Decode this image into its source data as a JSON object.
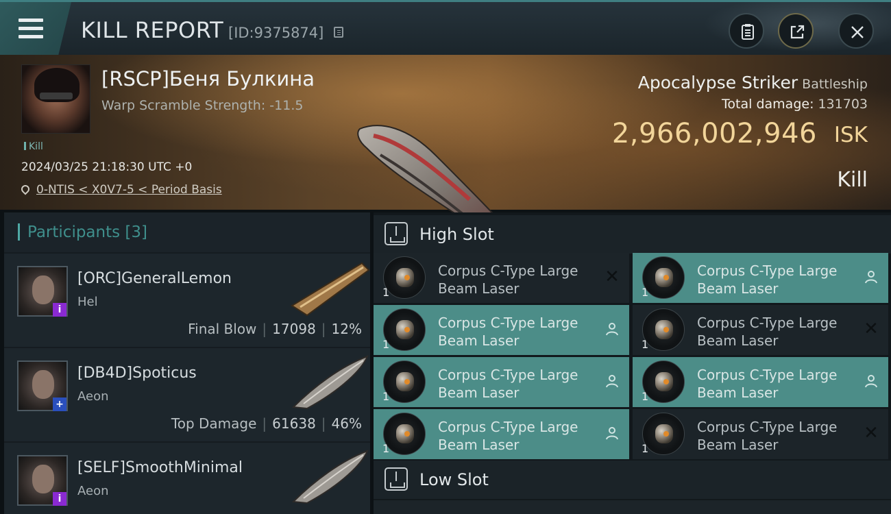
{
  "header": {
    "title": "KILL REPORT",
    "id_label": "[ID:9375874]"
  },
  "victim": {
    "name": "[RSCP]Беня Булкина",
    "warp_scramble": "Warp Scramble Strength: -11.5",
    "kill_tag": "Kill",
    "timestamp": "2024/03/25 21:18:30 UTC +0",
    "location": "0-NTIS < X0V7-5 < Period Basis",
    "ship_name": "Apocalypse Striker",
    "ship_class": "Battleship",
    "total_damage_label": "Total damage:",
    "total_damage": "131703",
    "isk_value": "2,966,002,946",
    "isk_unit": "ISK",
    "outcome": "Kill"
  },
  "participants": {
    "label": "Participants [3]",
    "items": [
      {
        "name": "[ORC]GeneralLemon",
        "ship": "Hel",
        "role": "Final Blow",
        "damage": "17098",
        "percent": "12%",
        "badge": "i"
      },
      {
        "name": "[DB4D]Spoticus",
        "ship": "Aeon",
        "role": "Top Damage",
        "damage": "61638",
        "percent": "46%",
        "badge": "+"
      },
      {
        "name": "[SELF]SmoothMinimal",
        "ship": "Aeon",
        "role": "",
        "damage": "",
        "percent": "",
        "badge": "i"
      }
    ]
  },
  "modules": {
    "high_slot_label": "High Slot",
    "low_slot_label": "Low Slot",
    "high": [
      {
        "line1": "Corpus C-Type Large",
        "line2": "Beam Laser",
        "qty": "1",
        "status": "destroyed",
        "fitted": false
      },
      {
        "line1": "Corpus C-Type Large",
        "line2": "Beam Laser",
        "qty": "1",
        "status": "dropped",
        "fitted": true
      },
      {
        "line1": "Corpus C-Type Large",
        "line2": "Beam Laser",
        "qty": "1",
        "status": "dropped",
        "fitted": true
      },
      {
        "line1": "Corpus C-Type Large",
        "line2": "Beam Laser",
        "qty": "1",
        "status": "destroyed",
        "fitted": false
      },
      {
        "line1": "Corpus C-Type Large",
        "line2": "Beam Laser",
        "qty": "1",
        "status": "dropped",
        "fitted": true
      },
      {
        "line1": "Corpus C-Type Large",
        "line2": "Beam Laser",
        "qty": "1",
        "status": "dropped",
        "fitted": true
      },
      {
        "line1": "Corpus C-Type Large",
        "line2": "Beam Laser",
        "qty": "1",
        "status": "dropped",
        "fitted": true
      },
      {
        "line1": "Corpus C-Type Large",
        "line2": "Beam Laser",
        "qty": "1",
        "status": "destroyed",
        "fitted": false
      }
    ]
  },
  "colors": {
    "accent_teal": "#4c8d88",
    "isk_gold": "#f2d59a",
    "badge_purple": "#8a2ad2",
    "badge_blue": "#2a4fbd"
  },
  "icons": [
    "menu-icon",
    "copy-icon",
    "report-icon",
    "share-icon",
    "close-icon",
    "location-pin-icon",
    "slot-icon",
    "person-icon",
    "x-icon"
  ]
}
